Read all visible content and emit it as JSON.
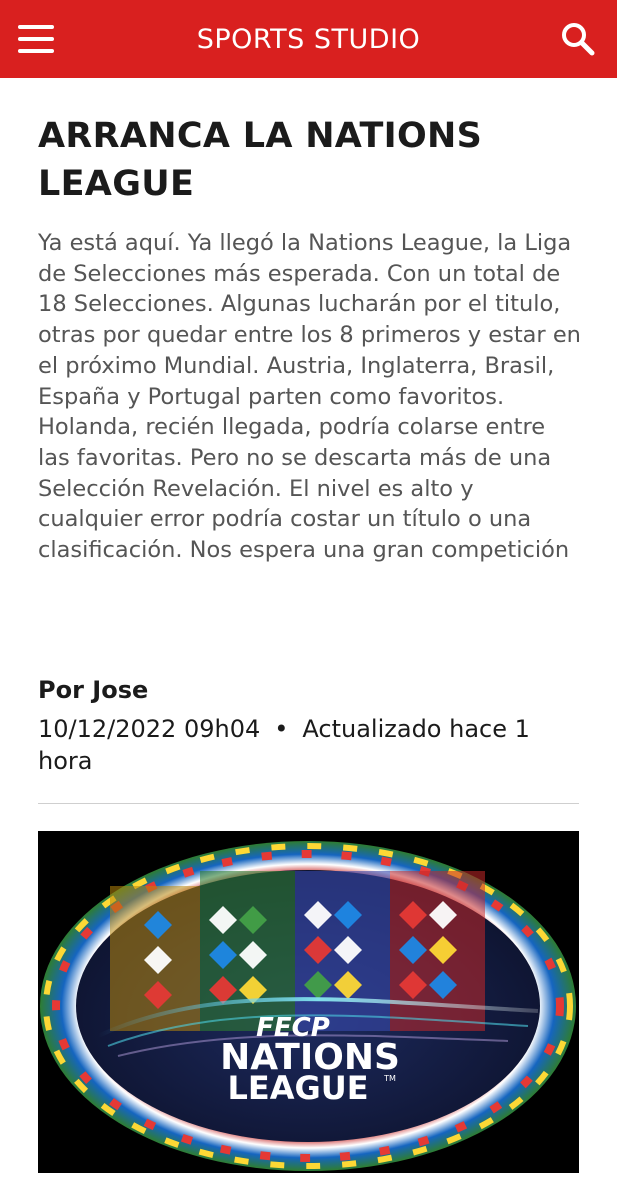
{
  "header": {
    "menu_icon": "hamburger-menu-icon",
    "brand": "SPORTS STUDIO",
    "search_icon": "search-icon",
    "accent_color": "#d9201f"
  },
  "article": {
    "title": "ARRANCA LA NATIONS LEAGUE",
    "body": "Ya está aquí. Ya llegó la Nations League, la Liga de Selecciones más esperada. Con un total de 18 Selecciones. Algunas lucharán por el titulo, otras por quedar entre los 8 primeros y estar en el próximo Mundial. Austria, Inglaterra, Brasil, España y Portugal parten como favoritos. Holanda, recién llegada, podría colarse entre las favoritas. Pero no se descarta más de una Selección Revelación. El nivel es alto y cualquier error podría costar un título o una clasificación. Nos espera una gran competición",
    "author": "Por Jose",
    "date": "10/12/2022 09h04",
    "separator": "•",
    "updated": "Actualizado hace 1 hora"
  },
  "hero_image": {
    "logo_line1": "FECP",
    "logo_line2": "NATIONS",
    "logo_line3": "LEAGUE",
    "trademark": "TM"
  }
}
